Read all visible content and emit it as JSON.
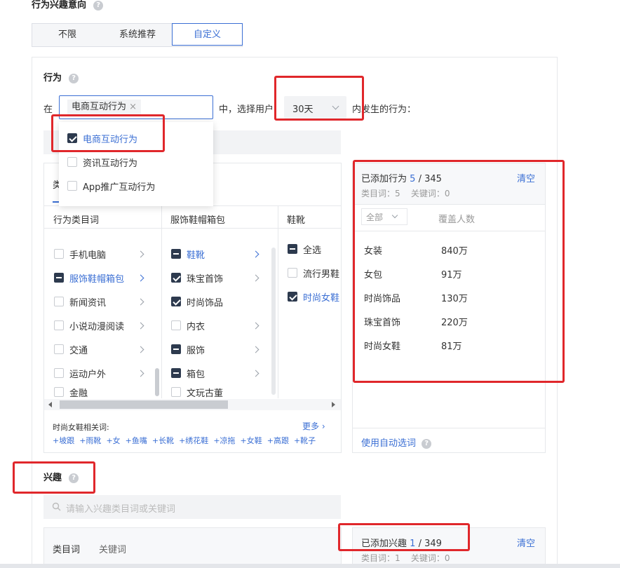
{
  "section_title": "行为兴趣意向",
  "help_glyph": "?",
  "segment": [
    "不限",
    "系统推荐",
    "自定义"
  ],
  "behavior": {
    "title": "行为",
    "prefix": "在",
    "selected_tag": "电商互动行为",
    "close_glyph": "×",
    "middle_text": "中，选择用户",
    "days": "30天",
    "suffix_text": "内发生的行为：",
    "dropdown_options": [
      "电商互动行为",
      "资讯互动行为",
      "App推广互动行为"
    ],
    "tabs_partial": "类",
    "col1_header": "行为类目词",
    "col2_header": "服饰鞋帽箱包",
    "col3_header": "鞋靴",
    "col1_items": [
      "手机电脑",
      "服饰鞋帽箱包",
      "新闻资讯",
      "小说动漫阅读",
      "交通",
      "运动户外",
      "金融"
    ],
    "col2_items": [
      "鞋靴",
      "珠宝首饰",
      "时尚饰品",
      "内衣",
      "服饰",
      "箱包",
      "文玩古董"
    ],
    "col3_items": [
      "全选",
      "流行男鞋",
      "时尚女鞋"
    ],
    "related_label": "时尚女鞋相关词:",
    "more_label": "更多 ›",
    "related_tags": [
      "+坡跟",
      "+雨靴",
      "+女",
      "+鱼嘴",
      "+长靴",
      "+绣花鞋",
      "+凉拖",
      "+女鞋",
      "+高跟",
      "+靴子"
    ],
    "added_label": "已添加行为",
    "added_count": "5",
    "added_total": "/ 345",
    "clear_label": "清空",
    "counts_line": "类目词：5    关键词：0",
    "filter_all": "全部",
    "coverage_header": "覆盖人数",
    "added_rows": [
      {
        "name": "女装",
        "value": "840万"
      },
      {
        "name": "女包",
        "value": "91万"
      },
      {
        "name": "时尚饰品",
        "value": "130万"
      },
      {
        "name": "珠宝首饰",
        "value": "220万"
      },
      {
        "name": "时尚女鞋",
        "value": "81万"
      }
    ],
    "auto_select": "使用自动选词"
  },
  "interest": {
    "title": "兴趣",
    "search_placeholder": "请输入兴趣类目词或关键词",
    "tab_category": "类目词",
    "tab_keyword": "关键词",
    "added_label": "已添加兴趣",
    "added_count": "1",
    "added_total": "/ 349",
    "clear_label": "清空",
    "counts_line": "类目词：1    关键词：0"
  }
}
